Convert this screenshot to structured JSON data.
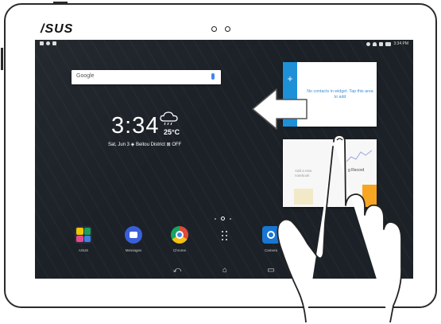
{
  "device": {
    "brand_logo": "/SUS"
  },
  "statusbar": {
    "time": "3:34 PM",
    "left_icons": [
      "gallery-icon",
      "moon-icon",
      "notification-icon"
    ],
    "right_icons": [
      "moon-icon",
      "wifi-icon",
      "sim-icon",
      "battery-icon"
    ]
  },
  "search": {
    "logo": "Google",
    "icon": "mic-icon"
  },
  "clock_widget": {
    "time": "3:34",
    "temperature": "25°C",
    "date_location": "Sat, Jun 3 ◈ Beitou District ⊠ OFF",
    "weather_icon": "rain-cloud-icon"
  },
  "contacts_widget": {
    "message": "No contacts in widget. Tap this area to add",
    "add_icon": "plus-icon",
    "note_icon": "note-icon"
  },
  "notes_card": {
    "left_text": "Add a new notebook",
    "right_text": "g Record"
  },
  "dock": {
    "apps": [
      {
        "label": "ASUS",
        "icon": "asus-folder-icon",
        "color": "#5a4fcf"
      },
      {
        "label": "Messages",
        "icon": "messages-icon",
        "color": "#3b5fd8"
      },
      {
        "label": "Chrome",
        "icon": "chrome-icon",
        "color": "#dd4b39"
      },
      {
        "label": "",
        "icon": "app-drawer-icon",
        "color": "#ffffff"
      },
      {
        "label": "Camera",
        "icon": "camera-icon",
        "color": "#1976d2"
      }
    ]
  },
  "navbar": {
    "back_icon": "back-icon",
    "home_icon": "home-icon",
    "recents_icon": "recents-icon"
  },
  "gesture": {
    "arrow_icon": "swipe-left-arrow-icon",
    "hand_icon": "hand-pointer-icon"
  },
  "colors": {
    "accent": "#1e90d8",
    "wallpaper": "#1b2127",
    "widget_text": "#3a8fd8"
  }
}
